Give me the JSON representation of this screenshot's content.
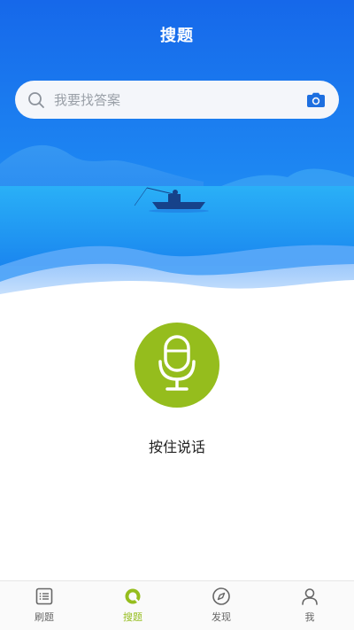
{
  "header": {
    "title": "搜题"
  },
  "search": {
    "placeholder": "我要找答案",
    "value": ""
  },
  "voice": {
    "label": "按住说话"
  },
  "tabbar": {
    "items": [
      {
        "label": "刷题",
        "icon": "list-icon",
        "active": false
      },
      {
        "label": "搜题",
        "icon": "search-tab-icon",
        "active": true
      },
      {
        "label": "发现",
        "icon": "compass-icon",
        "active": false
      },
      {
        "label": "我",
        "icon": "user-icon",
        "active": false
      }
    ]
  },
  "colors": {
    "brand_blue": "#1a6ff0",
    "accent_green": "#95bd1d",
    "camera_blue": "#1d6fe0"
  }
}
